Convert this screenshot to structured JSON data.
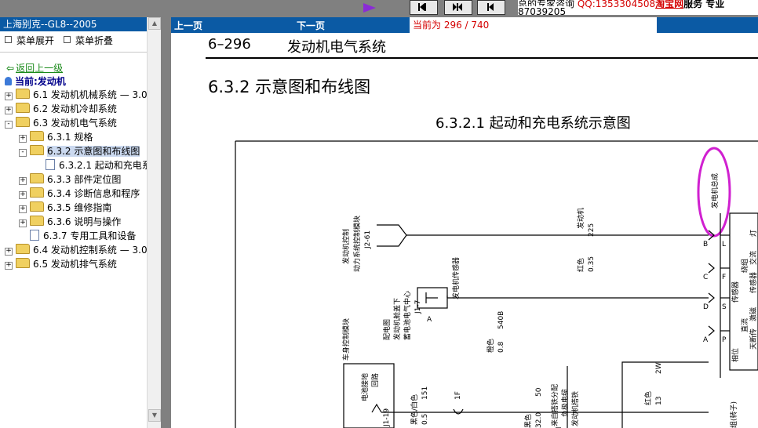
{
  "top": {
    "ad_text_a": "总的专家咨询 ",
    "ad_qq": "QQ:1353304508",
    "ad_text_b": "淘宝网",
    "ad_text_c": "服务 专业",
    "phone": "87039205"
  },
  "left": {
    "title": "上海别克--GL8--2005",
    "expand_label": "菜单展开",
    "collapse_label": "菜单折叠",
    "back_label": "返回上一级",
    "current_label": "当前:发动机",
    "tree": [
      {
        "label": "6.1 发动机机械系统 — 3.0",
        "pm": "+",
        "icon": "folder"
      },
      {
        "label": "6.2 发动机冷却系统",
        "pm": "+",
        "icon": "folder"
      },
      {
        "label": "6.3 发动机电气系统",
        "pm": "-",
        "icon": "folder-open"
      },
      {
        "label": "6.3.1 规格",
        "pm": "+",
        "icon": "folder"
      },
      {
        "label": "6.3.2 示意图和布线图",
        "pm": "-",
        "icon": "folder-open"
      },
      {
        "label": "6.3.2.1 起动和充电系",
        "pm": "",
        "icon": "document"
      },
      {
        "label": "6.3.3 部件定位图",
        "pm": "+",
        "icon": "folder"
      },
      {
        "label": "6.3.4 诊断信息和程序",
        "pm": "+",
        "icon": "folder"
      },
      {
        "label": "6.3.5 维修指南",
        "pm": "+",
        "icon": "folder"
      },
      {
        "label": "6.3.6 说明与操作",
        "pm": "+",
        "icon": "folder"
      },
      {
        "label": "6.3.7 专用工具和设备",
        "pm": "",
        "icon": "document"
      },
      {
        "label": "6.4 发动机控制系统 — 3.0",
        "pm": "+",
        "icon": "folder"
      },
      {
        "label": "6.5 发动机排气系统",
        "pm": "+",
        "icon": "folder"
      }
    ]
  },
  "nav": {
    "prev_label": "上一页",
    "next_label": "下一页",
    "page_indicator": "当前为  296 / 740"
  },
  "doc": {
    "page_number": "6–296",
    "section_title": "发动机电气系统",
    "heading": "6.3.2 示意图和布线图",
    "subheading": "6.3.2.1 起动和充电系统示意图"
  },
  "diagram": {
    "generator_assembly": "发电机总成",
    "pcm_line1": "发动机控制",
    "pcm_line2": "动力系统控制模块",
    "pcm_conn": "J2-61",
    "gen_label": "发动机",
    "wire_225_color": "红色",
    "wire_225_size": "0.35",
    "wire_225_num": "225",
    "sensor_label": "发电机传感器",
    "distrib_line1": "配电图",
    "distrib_line2": "发动机舱盖下",
    "distrib_line3": "蓄电池电气中心",
    "distrib_conn": "J1-7",
    "wire_540_color": "橙色",
    "wire_540_size": "0.8",
    "wire_540_num": "540B",
    "body_module": "车身控制模块",
    "bat_ground_1": "电池接地",
    "bat_ground_2": "回路",
    "j1_19": "J1-19",
    "wire_151_color": "黑色/白色",
    "wire_151_size": "0.5",
    "wire_151_num": "151",
    "splice_1f": "1F",
    "ground_1": "来自搭铁分配",
    "ground_2": "负极电缆",
    "ground_3": "发动机搭铁",
    "wire_50_color": "黑色",
    "wire_50_size": "32.0",
    "wire_50_num": "50",
    "wire_2w_color": "红色",
    "wire_2w_size": "13",
    "wire_2w_num": "2W",
    "pins": [
      "B",
      "C",
      "D",
      "A"
    ],
    "pins2": [
      "L",
      "F",
      "S",
      "P"
    ],
    "coil_labels": [
      "相位",
      "直流",
      "传感器",
      "绕组"
    ],
    "right_labels": [
      "灯",
      "交流",
      "传感器",
      "激磁",
      "天断传"
    ],
    "rotor": "组(转子)"
  }
}
